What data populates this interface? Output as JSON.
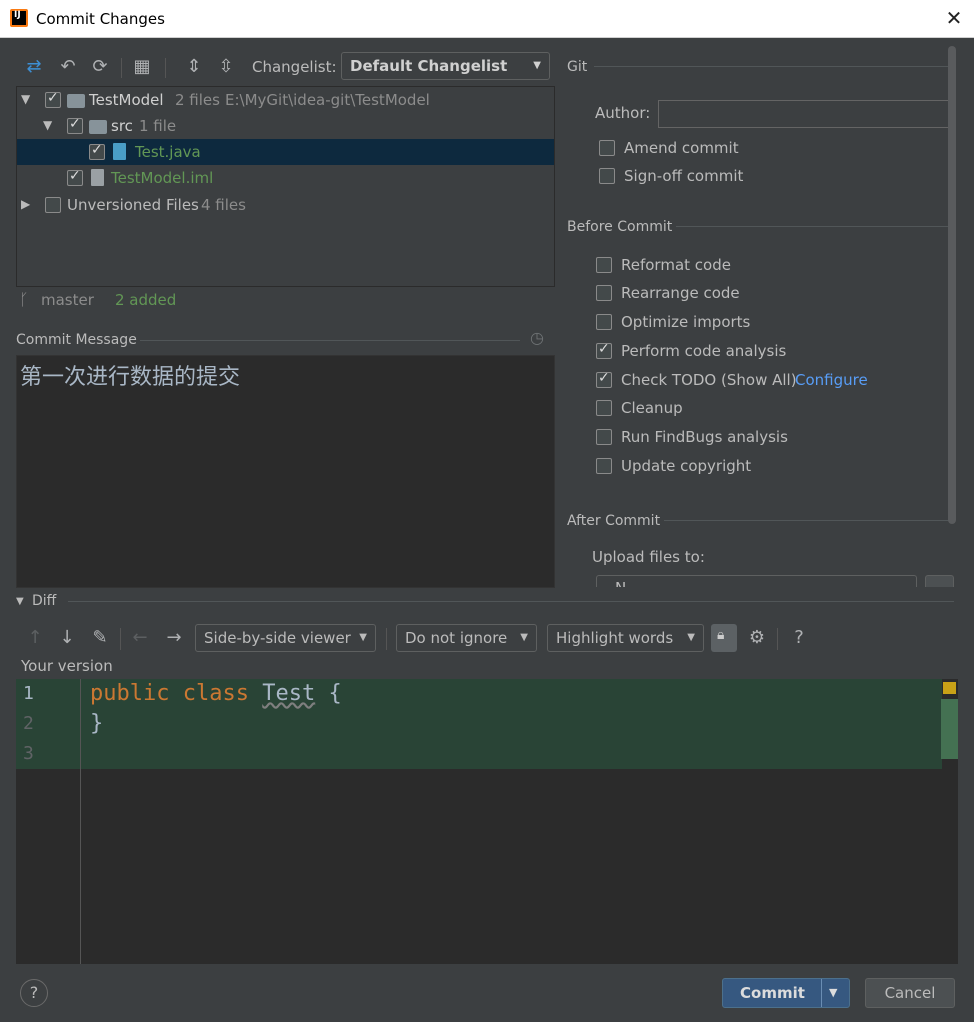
{
  "window": {
    "title": "Commit Changes"
  },
  "toolbar": {
    "changelist_label": "Changelist:",
    "changelist_value": "Default Changelist"
  },
  "tree": {
    "root": {
      "name": "TestModel",
      "count": "2 files",
      "path": "E:\\MyGit\\idea-git\\TestModel"
    },
    "src": {
      "name": "src",
      "count": "1 file"
    },
    "file1": {
      "name": "Test.java"
    },
    "file2": {
      "name": "TestModel.iml"
    },
    "unversioned": {
      "name": "Unversioned Files",
      "count": "4 files"
    }
  },
  "status": {
    "branch": "master",
    "added": "2 added"
  },
  "commit_message": {
    "label": "Commit Message",
    "text": "第一次进行数据的提交"
  },
  "git": {
    "header": "Git",
    "author_label": "Author:",
    "author_value": "",
    "amend": "Amend commit",
    "signoff": "Sign-off commit"
  },
  "before_commit": {
    "header": "Before Commit",
    "options": [
      {
        "label": "Reformat code",
        "checked": false
      },
      {
        "label": "Rearrange code",
        "checked": false
      },
      {
        "label": "Optimize imports",
        "checked": false
      },
      {
        "label": "Perform code analysis",
        "checked": true
      },
      {
        "label": "Check TODO (Show All)",
        "checked": true
      },
      {
        "label": "Cleanup",
        "checked": false
      },
      {
        "label": "Run FindBugs analysis",
        "checked": false
      },
      {
        "label": "Update copyright",
        "checked": false
      }
    ],
    "configure_link": "Configure"
  },
  "after_commit": {
    "header": "After Commit",
    "upload_label": "Upload files to:",
    "upload_value": "N"
  },
  "diff": {
    "header": "Diff",
    "viewer": "Side-by-side viewer",
    "ignore": "Do not ignore",
    "highlight": "Highlight words",
    "version_label": "Your version",
    "line_numbers": [
      "1",
      "2",
      "3"
    ],
    "code": {
      "kw1": "public",
      "kw2": "class",
      "name": "Test",
      "brace_open": "{",
      "brace_close": "}"
    }
  },
  "buttons": {
    "help": "?",
    "commit": "Commit",
    "cancel": "Cancel"
  },
  "colors": {
    "accent": "#4a88c7",
    "added": "#629755",
    "keyword": "#cc7832",
    "selection": "#0d293e",
    "diff_added": "#294436"
  }
}
